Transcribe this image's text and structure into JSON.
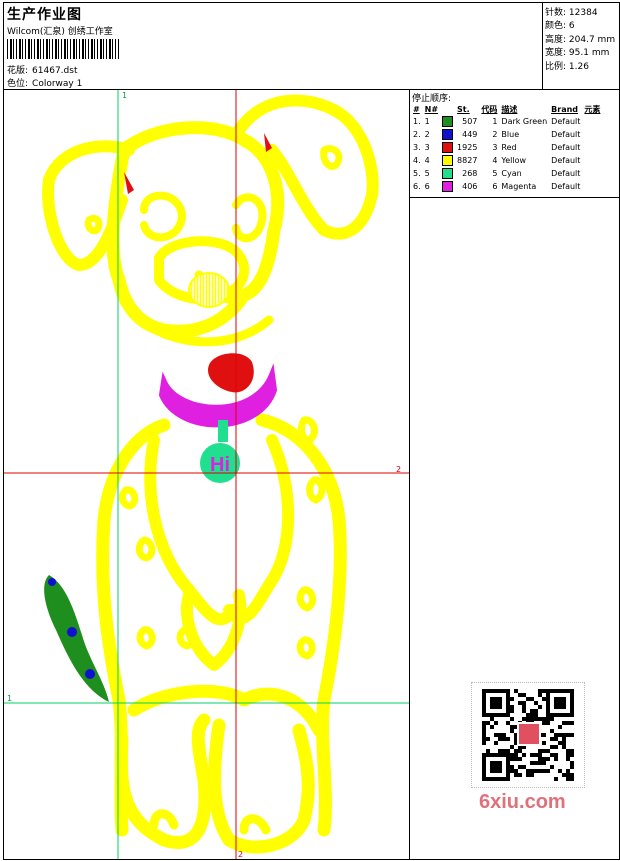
{
  "header": {
    "title": "生产作业图",
    "company": "Wilcom(汇泉) 创绣工作室",
    "design_label": "花版:",
    "design_value": "61467.dst",
    "colorway_label": "色位:",
    "colorway_value": "Colorway 1"
  },
  "stats": [
    {
      "label": "针数:",
      "value": "12384"
    },
    {
      "label": "颜色:",
      "value": "6"
    },
    {
      "label": "高度:",
      "value": "204.7 mm"
    },
    {
      "label": "宽度:",
      "value": "95.1 mm"
    },
    {
      "label": "比例:",
      "value": "1.26"
    }
  ],
  "guides": {
    "left_top": "1",
    "left_bottom": "1",
    "right_mid": "2",
    "bottom_mid": "2"
  },
  "stop_sequence": {
    "title": "停止顺序:",
    "headers": [
      "#",
      "N#",
      "St.",
      "代码",
      "描述",
      "Brand",
      "元素"
    ],
    "rows": [
      {
        "idx": "1.",
        "n": "1",
        "color": "#1e8f1e",
        "st": "507",
        "code": "1",
        "desc": "Dark Green",
        "brand": "Default"
      },
      {
        "idx": "2.",
        "n": "2",
        "color": "#1010d0",
        "st": "449",
        "code": "2",
        "desc": "Blue",
        "brand": "Default"
      },
      {
        "idx": "3.",
        "n": "3",
        "color": "#e01010",
        "st": "1925",
        "code": "3",
        "desc": "Red",
        "brand": "Default"
      },
      {
        "idx": "4.",
        "n": "4",
        "color": "#ffff00",
        "st": "8827",
        "code": "4",
        "desc": "Yellow",
        "brand": "Default"
      },
      {
        "idx": "5.",
        "n": "5",
        "color": "#20e090",
        "st": "268",
        "code": "5",
        "desc": "Cyan",
        "brand": "Default"
      },
      {
        "idx": "6.",
        "n": "6",
        "color": "#e020e0",
        "st": "406",
        "code": "6",
        "desc": "Magenta",
        "brand": "Default"
      }
    ]
  },
  "design": {
    "tag_text": "Hi",
    "colors": {
      "yellow": "#ffff00",
      "red": "#e01010",
      "magenta": "#e020e0",
      "cyan": "#20e090",
      "green": "#1e8f1e",
      "blue": "#1010d0",
      "guide_green": "#00d060",
      "guide_red": "#e00000"
    }
  },
  "watermark": "6xiu.com"
}
